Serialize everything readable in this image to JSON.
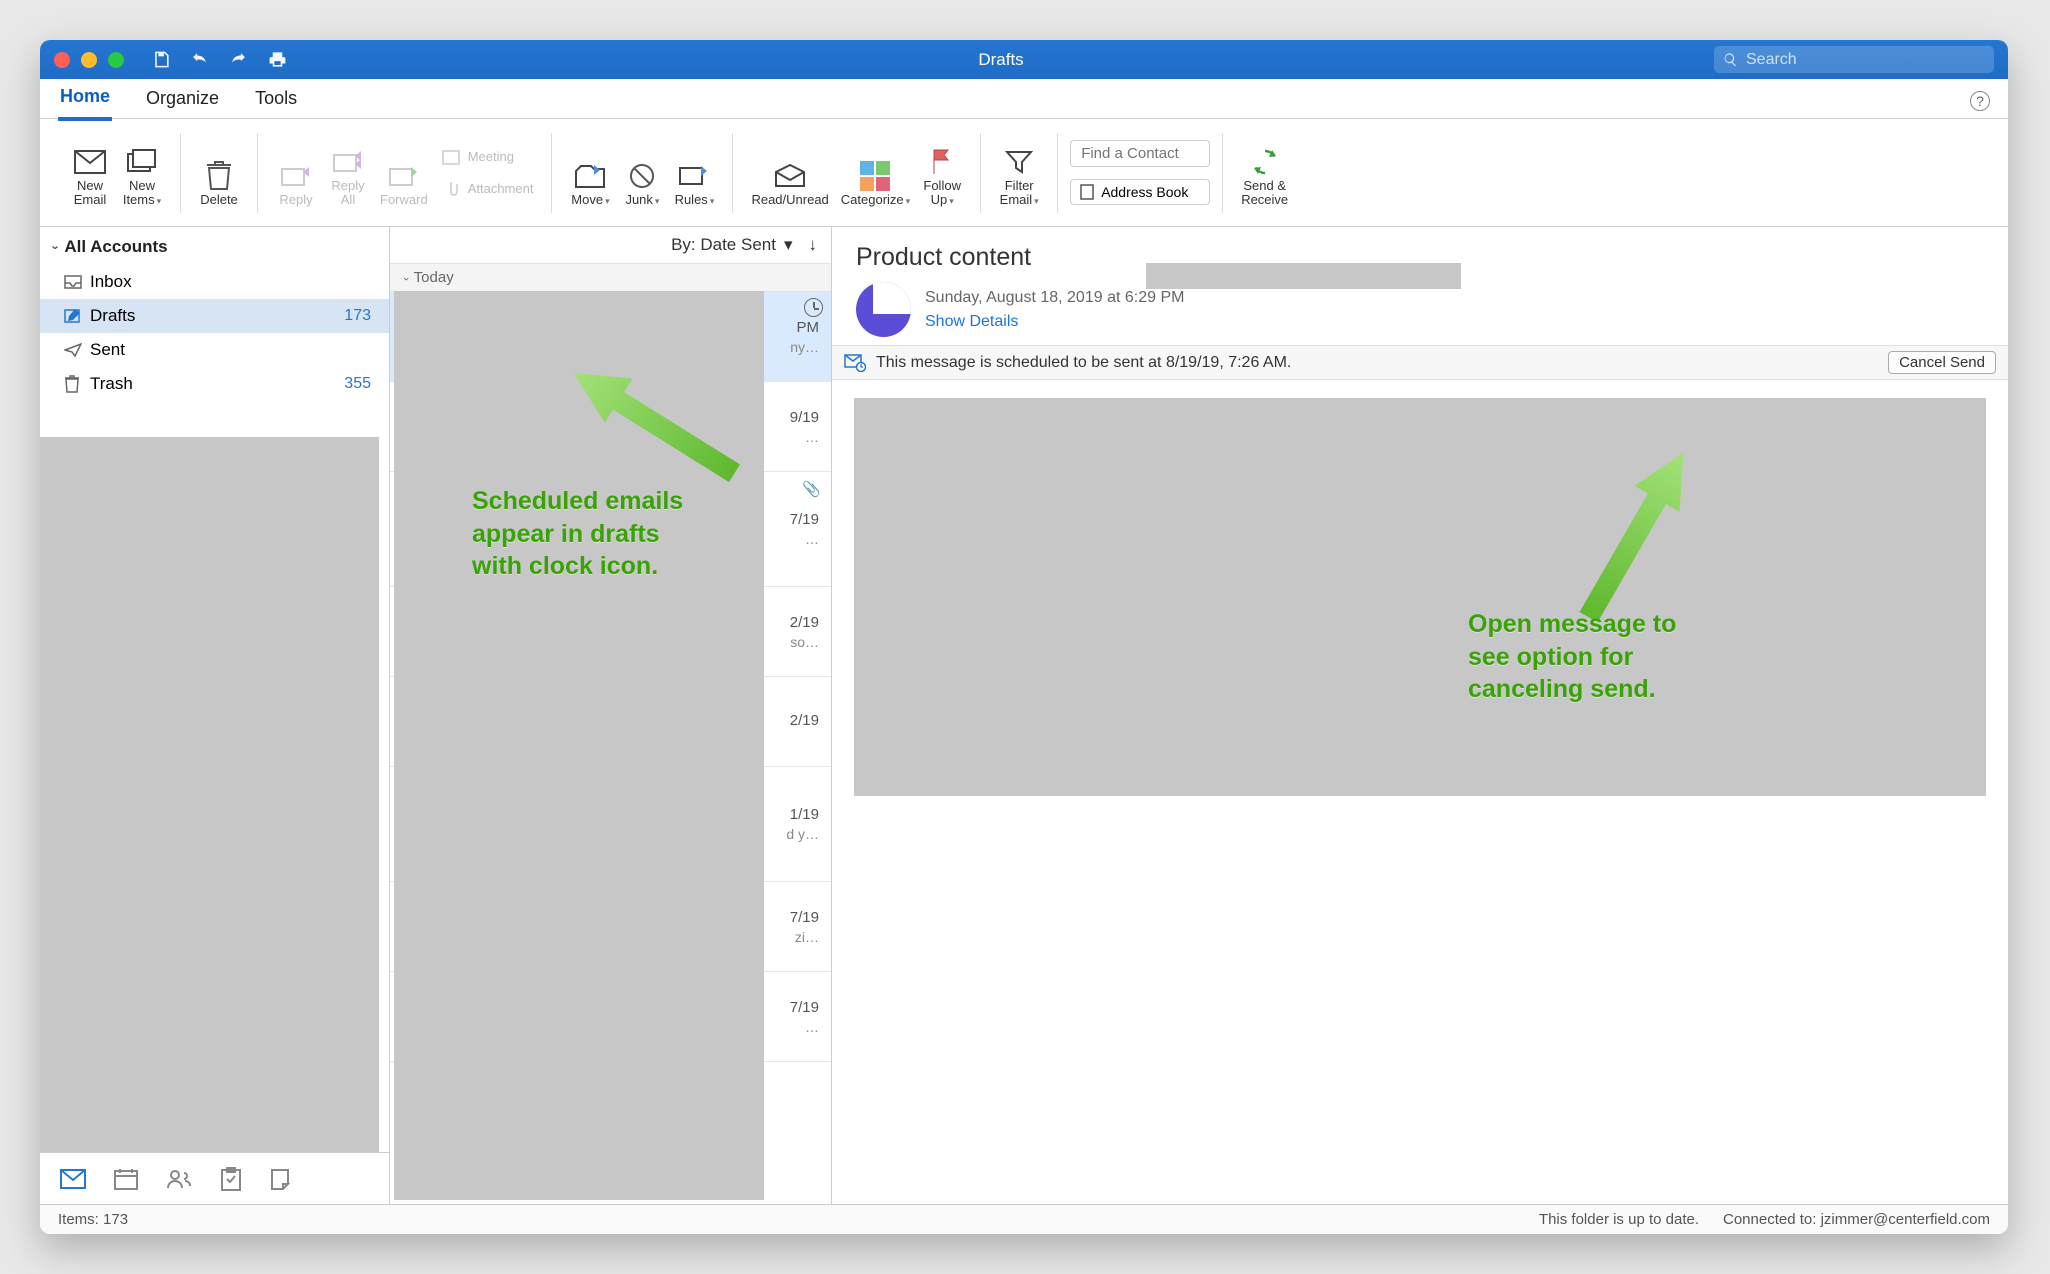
{
  "window": {
    "title": "Drafts",
    "search_placeholder": "Search"
  },
  "tabs": {
    "home": "Home",
    "organize": "Organize",
    "tools": "Tools"
  },
  "ribbon": {
    "new_email": "New\nEmail",
    "new_items": "New\nItems",
    "delete": "Delete",
    "reply": "Reply",
    "reply_all": "Reply\nAll",
    "forward": "Forward",
    "meeting": "Meeting",
    "attachment": "Attachment",
    "move": "Move",
    "junk": "Junk",
    "rules": "Rules",
    "read_unread": "Read/Unread",
    "categorize": "Categorize",
    "follow_up": "Follow\nUp",
    "filter_email": "Filter\nEmail",
    "find_contact": "Find a Contact",
    "address_book": "Address Book",
    "send_receive": "Send &\nReceive"
  },
  "sidebar": {
    "all_accounts": "All Accounts",
    "folders": [
      {
        "name": "Inbox",
        "count": ""
      },
      {
        "name": "Drafts",
        "count": "173"
      },
      {
        "name": "Sent",
        "count": ""
      },
      {
        "name": "Trash",
        "count": "355"
      }
    ]
  },
  "msglist": {
    "sort_label": "By: Date Sent",
    "group": "Today",
    "items": [
      {
        "date": "PM",
        "preview": "ny…"
      },
      {
        "date": "9/19",
        "preview": "…"
      },
      {
        "date": "7/19",
        "preview": "…",
        "attach": true
      },
      {
        "date": "2/19",
        "preview": "so…"
      },
      {
        "date": "2/19",
        "preview": ""
      },
      {
        "date": "1/19",
        "preview": "d y…"
      },
      {
        "date": "7/19",
        "preview": "zi…"
      },
      {
        "date": "7/19",
        "preview": "…"
      }
    ]
  },
  "reader": {
    "subject": "Product content",
    "date": "Sunday, August 18, 2019 at 6:29 PM",
    "show_details": "Show Details",
    "info_text": "This message is scheduled to be sent at 8/19/19, 7:26 AM.",
    "cancel_send": "Cancel Send"
  },
  "status": {
    "items": "Items: 173",
    "sync": "This folder is up to date.",
    "conn": "Connected to: jzimmer@centerfield.com"
  },
  "annotations": {
    "left": "Scheduled emails\nappear in drafts\nwith clock icon.",
    "right": "Open message to\nsee option for\ncanceling send."
  }
}
